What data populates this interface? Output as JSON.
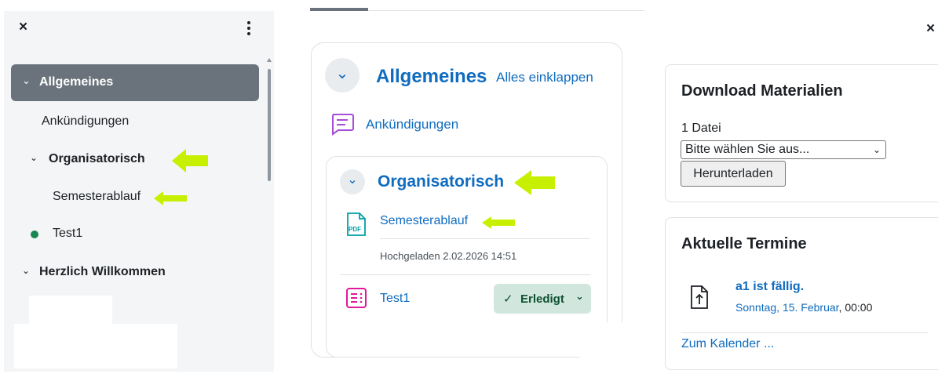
{
  "drawer": {
    "close_icon": "×",
    "menu_icon": "more-vertical",
    "items": [
      {
        "label": "Allgemeines",
        "active": true
      },
      {
        "label": "Ankündigungen"
      },
      {
        "label": "Organisatorisch"
      },
      {
        "label": "Semesterablauf"
      },
      {
        "label": "Test1",
        "status_color": "#198754"
      },
      {
        "label": "Herzlich Willkommen"
      }
    ]
  },
  "course": {
    "section_title": "Allgemeines",
    "collapse_all": "Alles einklappen",
    "announcement": "Ankündigungen",
    "subsection_title": "Organisatorisch",
    "file_name": "Semesterablauf",
    "file_icon_label": "PDF",
    "uploaded": "Hochgeladen 2.02.2026 14:51",
    "activity_name": "Test1",
    "done_label": "Erledigt",
    "done_color": "#d1e7dd"
  },
  "right": {
    "close_icon": "×",
    "download": {
      "title": "Download Materialien",
      "count": "1 Datei",
      "select_value": "Bitte wählen Sie aus...",
      "button": "Herunterladen"
    },
    "events": {
      "title": "Aktuelle Termine",
      "event_title": "a1 ist fällig.",
      "event_date_link": "Sonntag, 15. Februar",
      "event_time": ", 00:00",
      "calendar_link": "Zum Kalender ..."
    }
  },
  "colors": {
    "accent": "#0f6cbf",
    "annotation_arrow": "#c6f000",
    "active_item": "#6a737b"
  }
}
